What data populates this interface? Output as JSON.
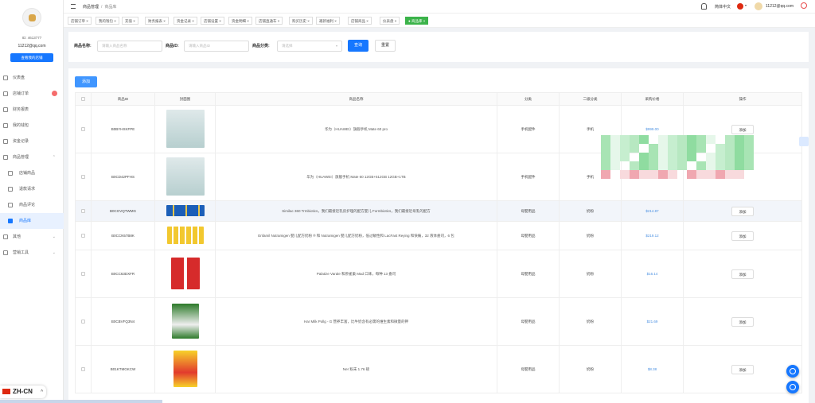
{
  "sidebar": {
    "user_id": "ID: 4613777",
    "email": "11212@qq.com",
    "shop_button": "查看我的店铺",
    "items": [
      {
        "label": "仪表盘",
        "icon": "dashboard-icon"
      },
      {
        "label": "店铺订单",
        "icon": "order-icon",
        "badge": true
      },
      {
        "label": "财务报表",
        "icon": "report-icon"
      },
      {
        "label": "我的钱包",
        "icon": "wallet-icon"
      },
      {
        "label": "资金记录",
        "icon": "record-icon"
      },
      {
        "label": "商品管理",
        "icon": "product-icon",
        "expanded": true
      },
      {
        "label": "店铺商品",
        "icon": "store-icon",
        "sub": true
      },
      {
        "label": "退款请求",
        "icon": "refund-icon",
        "sub": true
      },
      {
        "label": "商品评论",
        "icon": "comment-icon",
        "sub": true
      },
      {
        "label": "商品库",
        "icon": "home-icon",
        "sub": true,
        "active": true
      },
      {
        "label": "其他",
        "icon": "grid-icon"
      },
      {
        "label": "营销工具",
        "icon": "chart-icon"
      }
    ],
    "lang": "ZH-CN"
  },
  "header": {
    "breadcrumb_root": "商品管理",
    "breadcrumb_current": "商品库",
    "language": "简体中文",
    "user": "11212@qq.com"
  },
  "tabs": [
    {
      "label": "店铺订单"
    },
    {
      "label": "我的钱包"
    },
    {
      "label": "充值"
    },
    {
      "label": "财务报表"
    },
    {
      "label": "资金记录"
    },
    {
      "label": "店铺设置"
    },
    {
      "label": "资金明细"
    },
    {
      "label": "店铺直通车"
    },
    {
      "label": "购买历史"
    },
    {
      "label": "邀新福利"
    },
    {
      "label": "店铺商品"
    },
    {
      "label": "仪表盘"
    },
    {
      "label": "● 商品库",
      "active": true
    }
  ],
  "search": {
    "name_label": "商品名称:",
    "name_placeholder": "请输入商品名称",
    "id_label": "商品ID:",
    "id_placeholder": "请输入商品ID",
    "category_label": "商品分类:",
    "category_placeholder": "请选择",
    "query_button": "查询",
    "reset_button": "重置"
  },
  "table": {
    "add_button": "添加",
    "columns": [
      "商品ID",
      "封面图",
      "商品名称",
      "分类",
      "二级分类",
      "采购价格",
      "操作"
    ],
    "action_label": "添加",
    "rows": [
      {
        "id": "B0BYHXKFPE",
        "title": "华为（HUAWEI）旗舰手机 Mate 60 pro",
        "cat": "手机配件",
        "sub": "手机",
        "price": "$999.00",
        "img": "phone"
      },
      {
        "id": "B0CD42PFHS",
        "title": "华为（HUAWEI）旗舰手机 Mate 60 12GB+512GB 12GB+1TB",
        "cat": "手机配件",
        "sub": "手机",
        "price": "",
        "img": "phone"
      },
      {
        "id": "B0CGVQTWMG",
        "title": "Similac 360 Trmbiotics，我们最接近乳房护理的配方婴儿 Formbiotics，我们最接近母乳的配方",
        "cat": "母婴用品",
        "sub": "奶粉",
        "price": "$214.87",
        "img": "boxes"
      },
      {
        "id": "B0CCN57B8K",
        "title": "Enfamil Nutramigen 婴儿配方奶粉 ® 和 Nutramigen 婴儿配方奶粉，低过敏性和 LacFast Reying 和快痛，32 液体盎司，6 包",
        "cat": "母婴用品",
        "sub": "奶粉",
        "price": "$219.12",
        "img": "bottles"
      },
      {
        "id": "B0CC63DXFR",
        "title": "Palatize Varale 和原雀巢 Mad 口味，每种 13 盎司",
        "cat": "母婴用品",
        "sub": "奶粉",
        "price": "$16.14",
        "img": "cans"
      },
      {
        "id": "B0CBVFQ3N4",
        "title": "Har Milk Pollg - G 营养丰富，比牛奶含有必需的维生素和微量的钾",
        "cat": "母婴用品",
        "sub": "奶粉",
        "price": "$21.69",
        "img": "bag"
      },
      {
        "id": "B01KTMGKCW",
        "title": "Ner 粉末 1.76 磅",
        "cat": "母婴用品",
        "sub": "奶粉",
        "price": "$8.38",
        "img": "nido"
      }
    ]
  }
}
